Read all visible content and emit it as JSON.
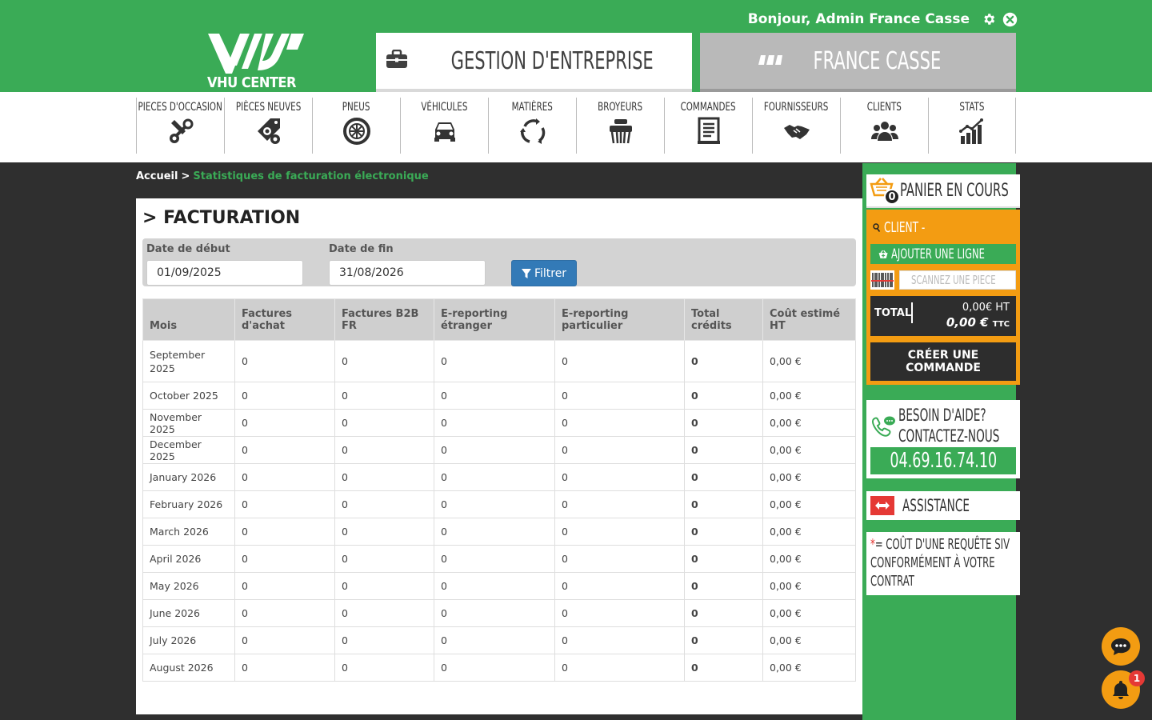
{
  "header": {
    "greeting": "Bonjour, Admin France Casse",
    "logo_text": "VHU CENTER",
    "tab_gestion": "GESTION D'ENTREPRISE",
    "tab_france": "FRANCE CASSE"
  },
  "nav": [
    {
      "label": "PIECES D'OCCASION",
      "icon": "tools-icon"
    },
    {
      "label": "PIÈCES NEUVES",
      "icon": "tagged-gears-icon"
    },
    {
      "label": "PNEUS",
      "icon": "tire-icon"
    },
    {
      "label": "VÉHICULES",
      "icon": "car-icon"
    },
    {
      "label": "MATIÈRES",
      "icon": "recycle-icon"
    },
    {
      "label": "BROYEURS",
      "icon": "shredder-icon"
    },
    {
      "label": "COMMANDES",
      "icon": "order-list-icon"
    },
    {
      "label": "FOURNISSEURS",
      "icon": "handshake-icon"
    },
    {
      "label": "CLIENTS",
      "icon": "users-icon"
    },
    {
      "label": "STATS",
      "icon": "bar-chart-icon"
    }
  ],
  "breadcrumb": {
    "home": "Accueil",
    "sep": ">",
    "current": "Statistiques de facturation électronique"
  },
  "main": {
    "title": "> FACTURATION",
    "start_label": "Date de début",
    "start_value": "01/09/2025",
    "end_label": "Date de fin",
    "end_value": "31/08/2026",
    "filter_button": "Filtrer"
  },
  "table": {
    "headers": [
      "Mois",
      "Factures d'achat",
      "Factures B2B FR",
      "E-reporting étranger",
      "E-reporting particulier",
      "Total crédits",
      "Coût estimé HT"
    ],
    "rows": [
      [
        "September 2025",
        "0",
        "0",
        "0",
        "0",
        "0",
        "0,00 €"
      ],
      [
        "October 2025",
        "0",
        "0",
        "0",
        "0",
        "0",
        "0,00 €"
      ],
      [
        "November 2025",
        "0",
        "0",
        "0",
        "0",
        "0",
        "0,00 €"
      ],
      [
        "December 2025",
        "0",
        "0",
        "0",
        "0",
        "0",
        "0,00 €"
      ],
      [
        "January 2026",
        "0",
        "0",
        "0",
        "0",
        "0",
        "0,00 €"
      ],
      [
        "February 2026",
        "0",
        "0",
        "0",
        "0",
        "0",
        "0,00 €"
      ],
      [
        "March 2026",
        "0",
        "0",
        "0",
        "0",
        "0",
        "0,00 €"
      ],
      [
        "April 2026",
        "0",
        "0",
        "0",
        "0",
        "0",
        "0,00 €"
      ],
      [
        "May 2026",
        "0",
        "0",
        "0",
        "0",
        "0",
        "0,00 €"
      ],
      [
        "June 2026",
        "0",
        "0",
        "0",
        "0",
        "0",
        "0,00 €"
      ],
      [
        "July 2026",
        "0",
        "0",
        "0",
        "0",
        "0",
        "0,00 €"
      ],
      [
        "August 2026",
        "0",
        "0",
        "0",
        "0",
        "0",
        "0,00 €"
      ]
    ]
  },
  "cart": {
    "count": "0",
    "title": "PANIER EN COURS",
    "client_label": "CLIENT -",
    "add_line": "AJOUTER UNE LIGNE",
    "scan_placeholder": "SCANNEZ UNE PIECE",
    "total_label": "TOTAL",
    "total_ht": "0,00€ HT",
    "total_ttc": "0,00 €",
    "ttc_suffix": "TTC",
    "create_order": "CRÉER UNE COMMANDE"
  },
  "help": {
    "line1": "BESOIN D'AIDE?",
    "line2": "CONTACTEZ-NOUS",
    "phone": "04.69.16.74.10"
  },
  "assistance": {
    "label": "ASSISTANCE"
  },
  "siv_note": {
    "star": "*",
    "line1": "= COÛT D'UNE REQUÊTE SIV",
    "line2": "CONFORMÉMENT À VOTRE",
    "line3": "CONTRAT"
  },
  "notifications": {
    "count": "1"
  },
  "colors": {
    "brand_green": "#3aab56",
    "accent_orange": "#f39c12",
    "button_blue": "#337ab7",
    "dark_bg": "#2f2f2f"
  }
}
